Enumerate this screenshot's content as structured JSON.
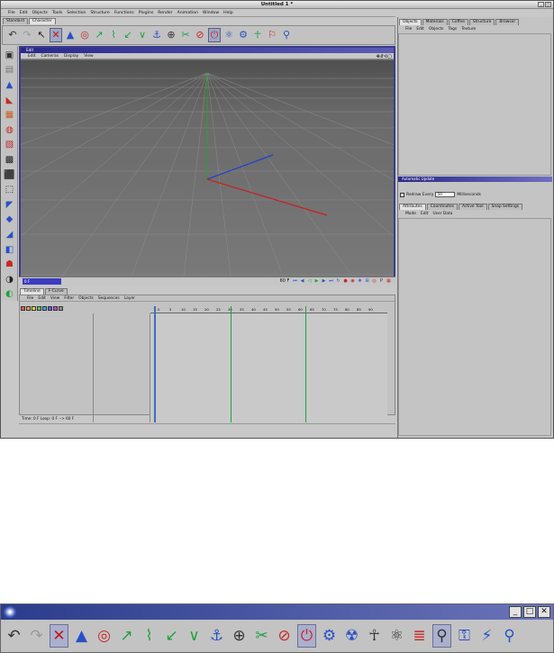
{
  "window": {
    "title": "Untitled 1 *"
  },
  "menu": [
    "File",
    "Edit",
    "Objects",
    "Tools",
    "Selection",
    "Structure",
    "Functions",
    "Plugins",
    "Render",
    "Animation",
    "Window",
    "Help"
  ],
  "layout_tabs": [
    "Standard",
    "Character"
  ],
  "toolbar_icons": [
    "↶",
    "↷",
    "↖",
    "✕",
    "▲",
    "◎",
    "↗",
    "⌇",
    "↙",
    "∨",
    "⚓",
    "⊕",
    "✂",
    "⊘",
    "⏻",
    "⚛",
    "⚙",
    "☥",
    "⚐",
    "⚲"
  ],
  "left_tools": [
    "▣",
    "▤",
    "▲",
    "◣",
    "▦",
    "◍",
    "▧",
    "▩",
    "⬛",
    "⬚",
    "◤",
    "◆",
    "◢",
    "◧",
    "☗",
    "◑",
    "◐"
  ],
  "viewport": {
    "title": "Edit",
    "menu": [
      "Edit",
      "Cameras",
      "Display",
      "View"
    ],
    "nav_icons": "✥⇵⟲▢"
  },
  "timebar": {
    "current": "0 F",
    "end": "60 F"
  },
  "timeline": {
    "tabs": [
      "Timeline",
      "F-Curve"
    ],
    "menu": [
      "File",
      "Edit",
      "View",
      "Filter",
      "Objects",
      "Sequences",
      "Layer"
    ],
    "ruler": [
      "0",
      "5",
      "10",
      "15",
      "20",
      "25",
      "30",
      "35",
      "40",
      "45",
      "50",
      "55",
      "60",
      "65",
      "70",
      "75",
      "80",
      "85",
      "90"
    ],
    "status": "Time: 0 F   Loop: 0 F --> 60 F"
  },
  "colors": [
    "#e05a5a",
    "#e8a640",
    "#e8d840",
    "#5ac85a",
    "#40a8e0",
    "#6060e0",
    "#c050c0",
    "#909090"
  ],
  "objects_panel": {
    "tabs": [
      "Objects",
      "Materials",
      "Coffee",
      "Structure",
      "Browser"
    ],
    "menu": [
      "File",
      "Edit",
      "Objects",
      "Tags",
      "Texture"
    ]
  },
  "automatic_save": {
    "title": "Automatic Update",
    "redraw_label": "Redraw Every",
    "redraw_value": "50",
    "unit": "Milliseconds"
  },
  "attributes_panel": {
    "tabs": [
      "Attributes",
      "Coordinates",
      "Active Tool",
      "Snap Settings"
    ],
    "menu": [
      "Mode",
      "Edit",
      "User Data"
    ]
  },
  "bottom_toolbar": {
    "icons": [
      "↶",
      "↷",
      "✕",
      "▲",
      "◎",
      "↗",
      "⌇",
      "↙",
      "∨",
      "⚓",
      "⊕",
      "✂",
      "⊘",
      "⏻",
      "⚙",
      "☢",
      "☥",
      "⚛",
      "≣",
      "⚲",
      "⚿",
      "⚡",
      "⚲"
    ],
    "win_buttons": [
      "_",
      "□",
      "✕"
    ]
  }
}
